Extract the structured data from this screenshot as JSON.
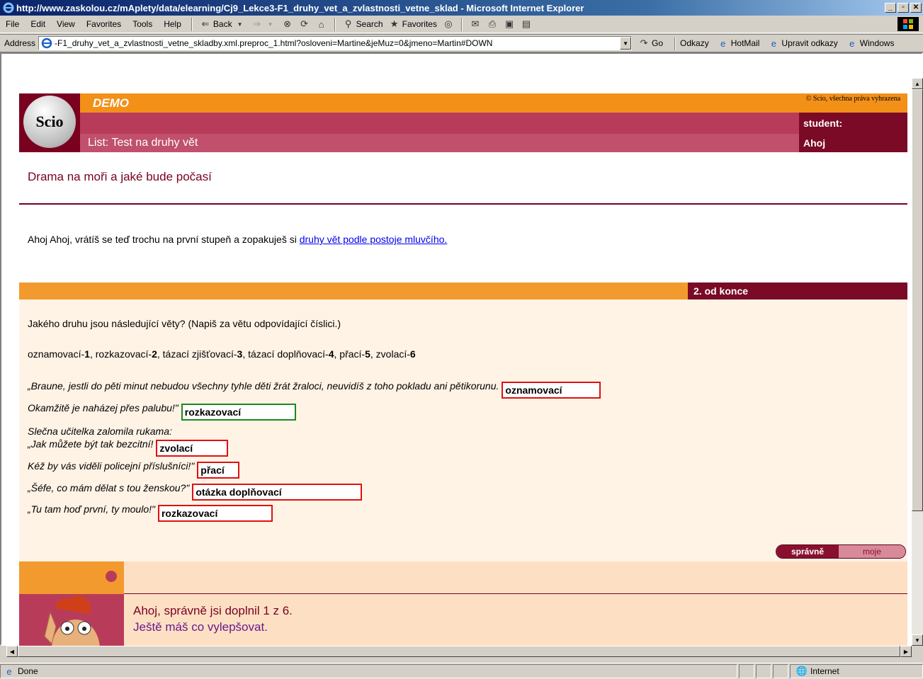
{
  "window": {
    "title": "http://www.zaskolou.cz/mAplety/data/elearning/Cj9_Lekce3-F1_druhy_vet_a_zvlastnosti_vetne_sklad - Microsoft Internet Explorer"
  },
  "menu": [
    "File",
    "Edit",
    "View",
    "Favorites",
    "Tools",
    "Help"
  ],
  "toolbar": {
    "back": "Back",
    "search": "Search",
    "favorites": "Favorites"
  },
  "address": {
    "label": "Address",
    "url": "-F1_druhy_vet_a_zvlastnosti_vetne_skladby.xml.preproc_1.html?osloveni=Martine&jeMuz=0&jmeno=Martin#DOWN",
    "go": "Go",
    "links": [
      "Odkazy",
      "HotMail",
      "Upravit odkazy",
      "Windows"
    ]
  },
  "header": {
    "logo": "Scio",
    "demo": "DEMO",
    "list_title": "List: Test na druhy vět",
    "copyright": "© Scio, všechna práva vyhrazena",
    "student_label": "student:",
    "student_name": "Ahoj"
  },
  "lesson": {
    "title": "Drama na moři a jaké bude počasí",
    "intro_text": "Ahoj Ahoj, vrátíš se teď trochu na první stupeň a zopakuješ si",
    "intro_link": "druhy vět podle postoje mluvčího."
  },
  "task": {
    "badge": "2. od konce",
    "question": "Jakého druhu jsou následující věty? (Napiš za větu odpovídající číslici.)",
    "legend": [
      {
        "name": "oznamovací-",
        "num": "1"
      },
      {
        "name": "rozkazovací-",
        "num": "2"
      },
      {
        "name": "tázací zjišťovací-",
        "num": "3"
      },
      {
        "name": "tázací doplňovací-",
        "num": "4"
      },
      {
        "name": "přací-",
        "num": "5"
      },
      {
        "name": "zvolací-",
        "num": "6"
      }
    ],
    "sentences": [
      {
        "text": "„Braune, jestli do pěti minut nebudou všechny tyhle děti žrát žraloci, neuvidíš z toho pokladu ani pětikorunu.",
        "answer": "oznamovací",
        "correct": false
      },
      {
        "text": "Okamžitě je naházej přes palubu!\"",
        "answer": "rozkazovací",
        "correct": true
      },
      {
        "text": "Slečna učitelka zalomila rukama:",
        "answer": null
      },
      {
        "text": "„Jak můžete být tak bezcitní!",
        "answer": "zvolací",
        "correct": false
      },
      {
        "text": "Kéž by vás viděli policejní příslušníci!\"",
        "answer": "přací",
        "correct": false
      },
      {
        "text": "„Šéfe, co mám dělat s tou ženskou?\"",
        "answer": "otázka doplňovací",
        "correct": false
      },
      {
        "text": "„Tu tam hoď první, ty moulo!\"",
        "answer": "rozkazovací",
        "correct": false
      }
    ],
    "toggle_correct": "správně",
    "toggle_mine": "moje"
  },
  "feedback": {
    "line1": "Ahoj, správně jsi doplnil 1 z 6.",
    "line2": "Ještě máš co vylepšovat."
  },
  "status": {
    "text": "Done",
    "zone": "Internet"
  }
}
